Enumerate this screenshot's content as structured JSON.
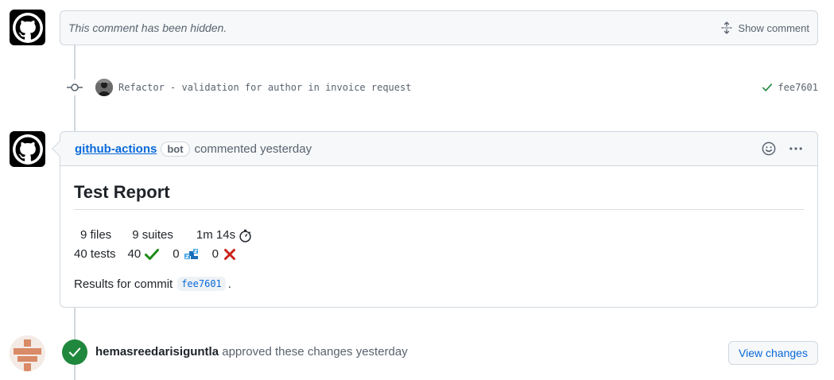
{
  "hidden_comment": {
    "text": "This comment has been hidden.",
    "show_label": "Show comment"
  },
  "commit": {
    "message": "Refactor - validation for author in invoice request",
    "sha": "fee7601"
  },
  "comment": {
    "author": "github-actions",
    "badge": "bot",
    "time": "commented yesterday",
    "title": "Test Report",
    "files": "9 files",
    "suites": "9 suites",
    "duration": "1m 14s",
    "tests": "40 tests",
    "passed": "40",
    "skipped": "0",
    "failed": "0",
    "results_prefix": "Results for commit",
    "results_sha": "fee7601",
    "results_suffix": "."
  },
  "review": {
    "user": "hemasreedarisiguntla",
    "text": "approved these changes yesterday",
    "button_label": "View changes"
  },
  "colors": {
    "accent": "#0969da",
    "success": "#1f883d",
    "muted": "#59636e",
    "border": "#d0d7de"
  }
}
